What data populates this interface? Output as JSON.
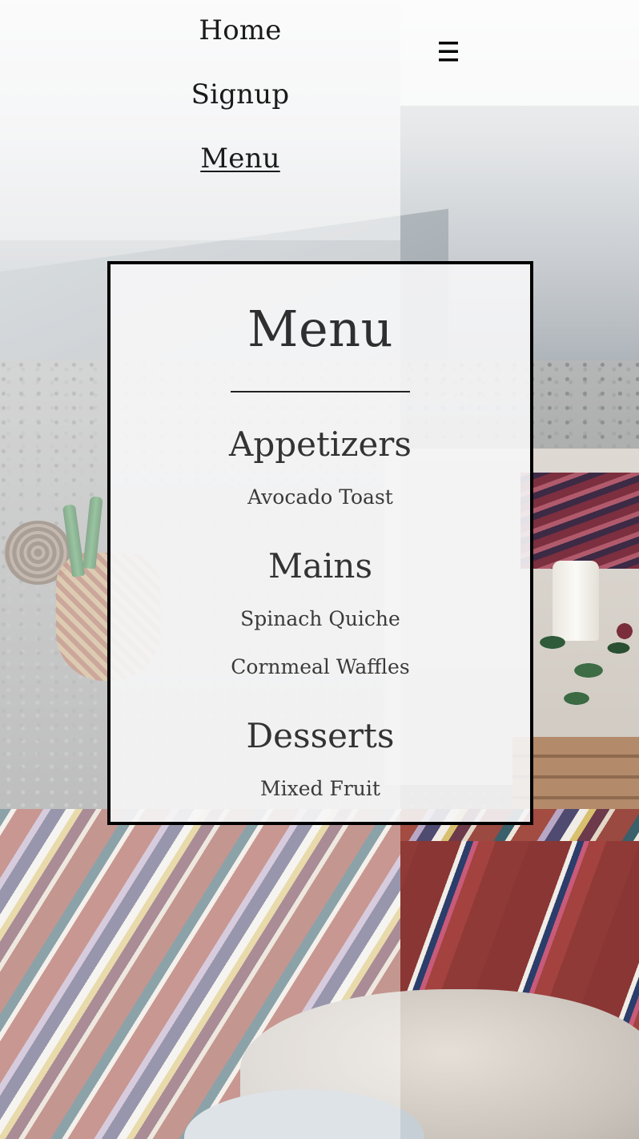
{
  "nav": {
    "links": [
      {
        "label": "Home",
        "active": false
      },
      {
        "label": "Signup",
        "active": false
      },
      {
        "label": "Menu",
        "active": true
      }
    ],
    "hamburger_icon": "hamburger-icon"
  },
  "menu": {
    "title": "Menu",
    "sections": [
      {
        "heading": "Appetizers",
        "items": [
          "Avocado Toast"
        ]
      },
      {
        "heading": "Mains",
        "items": [
          "Spinach Quiche",
          "Cornmeal Waffles"
        ]
      },
      {
        "heading": "Desserts",
        "items": [
          "Mixed Fruit"
        ]
      }
    ]
  },
  "colors": {
    "text": "#2a2a2a",
    "card_border": "#000000",
    "card_background": "#f6f6f7"
  }
}
